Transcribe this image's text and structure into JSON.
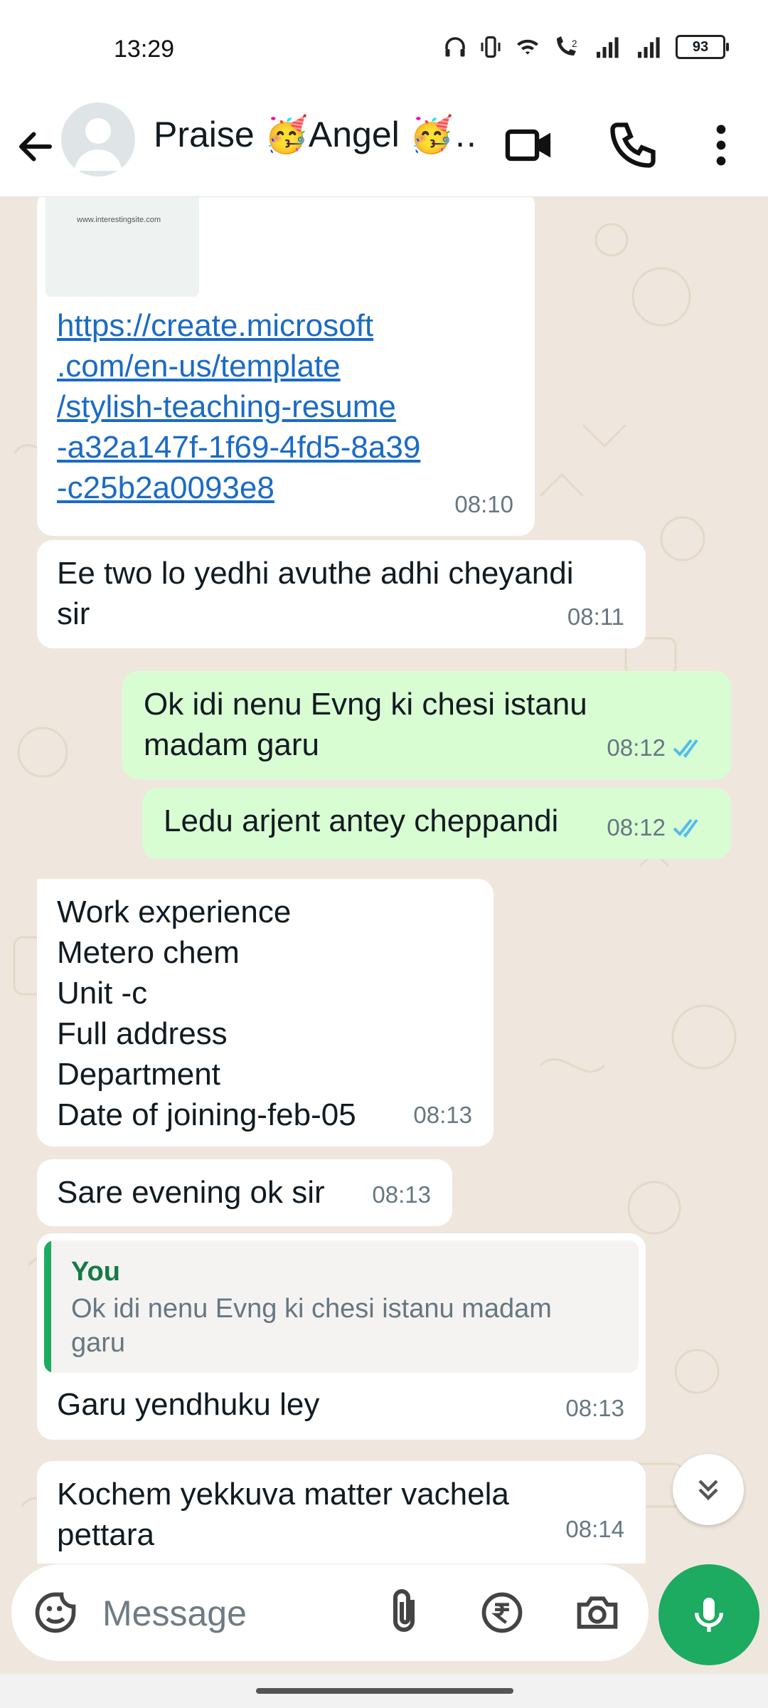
{
  "status_bar": {
    "time": "13:29",
    "battery": "93"
  },
  "header": {
    "contact_name": "Praise 🥳Angel 🥳…"
  },
  "messages": [
    {
      "link": "https://create.microsoft.com/en-us/template/stylish-teaching-resume-a32a147f-1f69-4fd5-8a39-c25b2a0093e8",
      "link_lines": [
        "https://create.microsoft",
        ".com/en-us/template",
        "/stylish-teaching-resume",
        "-a32a147f-1f69-4fd5-8a39",
        "-c25b2a0093e8"
      ],
      "preview_site": "www.interestingsite.com",
      "time": "08:10",
      "direction": "incoming"
    },
    {
      "lines": [
        "Ee two lo yedhi avuthe adhi cheyandi",
        "sir"
      ],
      "time": "08:11",
      "direction": "incoming"
    },
    {
      "lines": [
        "Ok idi  nenu Evng ki  chesi istanu",
        "madam garu"
      ],
      "time": "08:12",
      "direction": "outgoing",
      "status": "read"
    },
    {
      "lines": [
        "Ledu arjent antey cheppandi"
      ],
      "time": "08:12",
      "direction": "outgoing",
      "status": "read"
    },
    {
      "lines": [
        "Work experience",
        "Metero chem",
        "Unit -c",
        "Full address",
        "Department",
        "Date of joining-feb-05"
      ],
      "time": "08:13",
      "direction": "incoming"
    },
    {
      "lines": [
        "Sare evening ok sir"
      ],
      "time": "08:13",
      "direction": "incoming"
    },
    {
      "quote_author": "You",
      "quote_lines": [
        "Ok idi  nenu Evng ki  chesi istanu madam",
        "garu"
      ],
      "lines": [
        "Garu yendhuku ley"
      ],
      "time": "08:13",
      "direction": "incoming"
    },
    {
      "lines": [
        "Kochem yekkuva matter vachela",
        "pettara"
      ],
      "time": "08:14",
      "direction": "incoming"
    }
  ],
  "composer": {
    "placeholder": "Message"
  },
  "colors": {
    "incoming": "#ffffff",
    "outgoing": "#d9fdd3",
    "accent": "#1daa61",
    "read_ticks": "#53bdeb",
    "link": "#1a6bc5",
    "quote_bar": "#1daa61",
    "quote_author": "#127c46"
  },
  "icons": [
    "back-icon",
    "video-call-icon",
    "voice-call-icon",
    "more-icon",
    "sticker-icon",
    "attach-icon",
    "rupee-icon",
    "camera-icon",
    "mic-icon",
    "scroll-down-icon"
  ]
}
